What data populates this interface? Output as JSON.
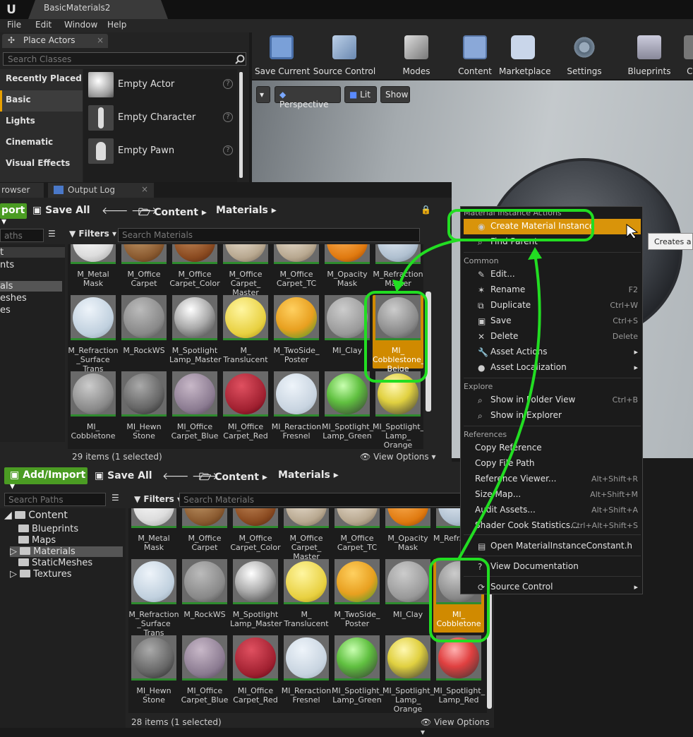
{
  "window": {
    "project_tab": "BasicMaterials2"
  },
  "menu": [
    "File",
    "Edit",
    "Window",
    "Help"
  ],
  "place_actors": {
    "tab_label": "Place Actors",
    "search_placeholder": "Search Classes",
    "categories": [
      "Recently Placed",
      "Basic",
      "Lights",
      "Cinematic",
      "Visual Effects"
    ],
    "active_category": "Basic",
    "items": [
      "Empty Actor",
      "Empty Character",
      "Empty Pawn"
    ]
  },
  "toolbar": [
    "Save Current",
    "Source Control",
    "Modes",
    "Content",
    "Marketplace",
    "Settings",
    "Blueprints",
    "Ci"
  ],
  "viewport": {
    "perspective": "Perspective",
    "lit": "Lit",
    "show": "Show"
  },
  "content_browser_1": {
    "tab_left": "rowser",
    "tab_output": "Output Log",
    "import_label": "port",
    "save_all": "Save All",
    "crumbs": [
      "Content",
      "Materials"
    ],
    "paths_placeholder": "aths",
    "filters": "Filters",
    "search_placeholder": "Search Materials",
    "left_tree": [
      "t",
      "nts",
      "als",
      "eshes",
      "es"
    ],
    "tiles": [
      "M_Metal Mask",
      "M_Office Carpet",
      "M_Office Carpet_Color",
      "M_Office Carpet_ Master",
      "M_Office Carpet_TC",
      "M_Opacity Mask",
      "M_Refraction Master",
      "M_Refraction _Surface Trans",
      "M_RockWS",
      "M_Spotlight Lamp_Master",
      "M_ Translucent",
      "M_TwoSide_ Poster",
      "MI_Clay",
      "MI_ Cobblestone_ Beige",
      "MI_ Cobbletone",
      "MI_Hewn Stone",
      "MI_Office Carpet_Blue",
      "MI_Office Carpet_Red",
      "MI_Reraction Fresnel",
      "MI_Spotlight_ Lamp_Green",
      "MI_Spotlight_ Lamp_ Orange"
    ],
    "status": "29 items (1 selected)",
    "view_options": "View Options"
  },
  "content_browser_2": {
    "import_label": "Add/Import",
    "save_all": "Save All",
    "crumbs": [
      "Content",
      "Materials"
    ],
    "paths_placeholder": "Search Paths",
    "filters": "Filters",
    "search_placeholder": "Search Materials",
    "tree": [
      "Content",
      "Blueprints",
      "Maps",
      "Materials",
      "StaticMeshes",
      "Textures"
    ],
    "tiles": [
      "M_Metal Mask",
      "M_Office Carpet",
      "M_Office Carpet_Color",
      "M_Office Carpet_ Master",
      "M_Office Carpet_TC",
      "M_Opacity Mask",
      "M_Refr..._M...",
      "M_Refraction _Surface Trans",
      "M_RockWS",
      "M_Spotlight Lamp_Master",
      "M_ Translucent",
      "M_TwoSide_ Poster",
      "MI_Clay",
      "MI_ Cobbletone",
      "MI_Hewn Stone",
      "MI_Office Carpet_Blue",
      "MI_Office Carpet_Red",
      "MI_Reraction Fresnel",
      "MI_Spotlight_ Lamp_Green",
      "MI_Spotlight_ Lamp_ Orange",
      "MI_Spotlight_ Lamp_Red"
    ],
    "status": "28 items (1 selected)",
    "view_options": "View Options"
  },
  "context_menu": {
    "section1": "Material Instance Actions",
    "create": "Create Material Instance",
    "find_parent": "Find Parent",
    "section_common": "Common",
    "common": [
      {
        "label": "Edit...",
        "shortcut": ""
      },
      {
        "label": "Rename",
        "shortcut": "F2"
      },
      {
        "label": "Duplicate",
        "shortcut": "Ctrl+W"
      },
      {
        "label": "Save",
        "shortcut": "Ctrl+S"
      },
      {
        "label": "Delete",
        "shortcut": "Delete"
      },
      {
        "label": "Asset Actions",
        "shortcut": ""
      },
      {
        "label": "Asset Localization",
        "shortcut": ""
      }
    ],
    "section_explore": "Explore",
    "explore": [
      {
        "label": "Show in Folder View",
        "shortcut": "Ctrl+B"
      },
      {
        "label": "Show in Explorer",
        "shortcut": ""
      }
    ],
    "section_refs": "References",
    "refs": [
      {
        "label": "Copy Reference",
        "shortcut": ""
      },
      {
        "label": "Copy File Path",
        "shortcut": ""
      },
      {
        "label": "Reference Viewer...",
        "shortcut": "Alt+Shift+R"
      },
      {
        "label": "Size Map...",
        "shortcut": "Alt+Shift+M"
      },
      {
        "label": "Audit Assets...",
        "shortcut": "Alt+Shift+A"
      },
      {
        "label": "Shader Cook Statistics...",
        "shortcut": "Ctrl+Alt+Shift+S"
      }
    ],
    "open_header": "Open MaterialInstanceConstant.h",
    "view_docs": "View Documentation",
    "source_control": "Source Control",
    "tooltip": "Creates a p"
  },
  "colors": {
    "accent": "#d9940a",
    "annotation": "#22dd22",
    "import_green": "#4b9c23"
  }
}
